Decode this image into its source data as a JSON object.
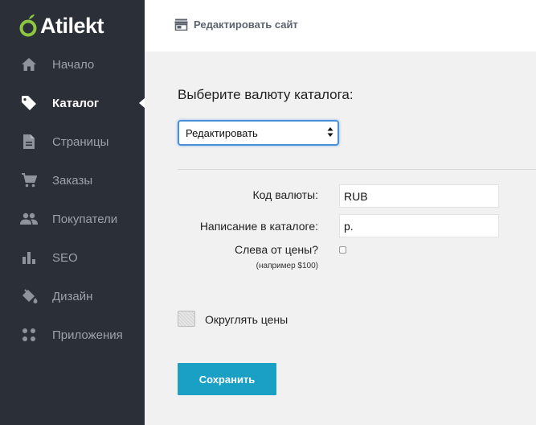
{
  "brand": {
    "name": "Atilekt",
    "accent_color": "#8dc63f"
  },
  "sidebar": {
    "items": [
      {
        "label": "Начало",
        "icon": "home-icon"
      },
      {
        "label": "Каталог",
        "icon": "tag-icon",
        "active": true
      },
      {
        "label": "Страницы",
        "icon": "document-icon"
      },
      {
        "label": "Заказы",
        "icon": "cart-icon"
      },
      {
        "label": "Покупатели",
        "icon": "people-icon"
      },
      {
        "label": "SEO",
        "icon": "bar-chart-icon"
      },
      {
        "label": "Дизайн",
        "icon": "paint-bucket-icon"
      },
      {
        "label": "Приложения",
        "icon": "apps-grid-icon"
      }
    ]
  },
  "topbar": {
    "edit_site_label": "Редактировать сайт",
    "icon": "storefront-icon"
  },
  "main": {
    "title": "Выберите валюту каталога:",
    "currency_select": {
      "selected": "Редактировать"
    },
    "fields": {
      "code_label": "Код валюты:",
      "code_value": "RUB",
      "spelling_label": "Написание в каталоге:",
      "spelling_value": "р.",
      "left_of_price_label": "Слева от цены?",
      "left_of_price_hint": "(например $100)",
      "round_prices_label": "Округлять цены"
    },
    "save_label": "Сохранить",
    "save_color": "#19a0c4"
  }
}
